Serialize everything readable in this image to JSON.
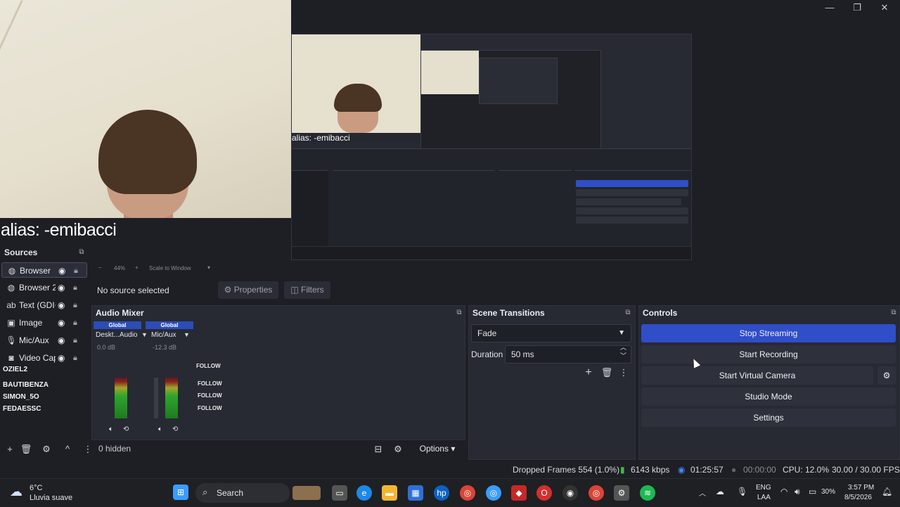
{
  "window": {
    "minimize": "—",
    "maximize": "❐",
    "close": "✕"
  },
  "webcam": {
    "overlay_text": "alias: -emibacci"
  },
  "preview": {
    "nested_overlay_text": "alias: -emibacci"
  },
  "scale_bar": {
    "zoom": "44%",
    "scale_label": "Scale to Window"
  },
  "sources": {
    "title": "Sources",
    "items": [
      {
        "label": "Browser",
        "icon": "globe-icon"
      },
      {
        "label": "Browser 2",
        "icon": "globe-icon"
      },
      {
        "label": "Text (GDI+",
        "icon": "text-icon"
      },
      {
        "label": "Image",
        "icon": "image-icon"
      },
      {
        "label": "Mic/Aux",
        "icon": "mic-icon"
      },
      {
        "label": "Video Cap",
        "icon": "camera-icon"
      }
    ]
  },
  "chat_overlay": {
    "names": [
      "OZIEL2",
      "BAUTIBENZA",
      "SIMON_5O",
      "FEDAESSC"
    ],
    "follow": "FOLLOW"
  },
  "context_bar": {
    "no_source": "No source selected",
    "properties": "Properties",
    "filters": "Filters"
  },
  "audio_mixer": {
    "title": "Audio Mixer",
    "channels": [
      {
        "badge": "Global",
        "name": "Deskt...Audio",
        "db": "0.0 dB",
        "level": 0.75
      },
      {
        "badge": "Global",
        "name": "Mic/Aux",
        "db": "-12.3 dB",
        "level": 0.6
      }
    ],
    "hidden": "0 hidden"
  },
  "scene_transitions": {
    "title": "Scene Transitions",
    "transition": "Fade",
    "duration_label": "Duration",
    "duration_value": "50 ms"
  },
  "controls": {
    "title": "Controls",
    "buttons": [
      "Stop Streaming",
      "Start Recording",
      "Start Virtual Camera",
      "Studio Mode",
      "Settings"
    ]
  },
  "sources_toolbar": {
    "add": "+",
    "remove": "🗑",
    "settings": "⚙",
    "up": "^",
    "more": "⋮"
  },
  "mixer_toolbar": {
    "options": "Options"
  },
  "status_bar": {
    "dropped_frames": "Dropped Frames 554 (1.0%)",
    "bitrate": "6143 kbps",
    "stream_time": "01:25:57",
    "record_time": "00:00:00",
    "cpu": "CPU: 12.0%",
    "fps": "30.00 / 30.00 FPS"
  },
  "taskbar": {
    "weather_temp": "6°C",
    "weather_desc": "Lluvia suave",
    "search": "Search",
    "lang1": "ENG",
    "lang2": "LAA",
    "battery": "30%",
    "time": "3:57 PM",
    "date": "8/5/2026"
  },
  "colors": {
    "accent": "#2f4ec8",
    "panel": "#272a33",
    "background": "#1e1f25"
  }
}
